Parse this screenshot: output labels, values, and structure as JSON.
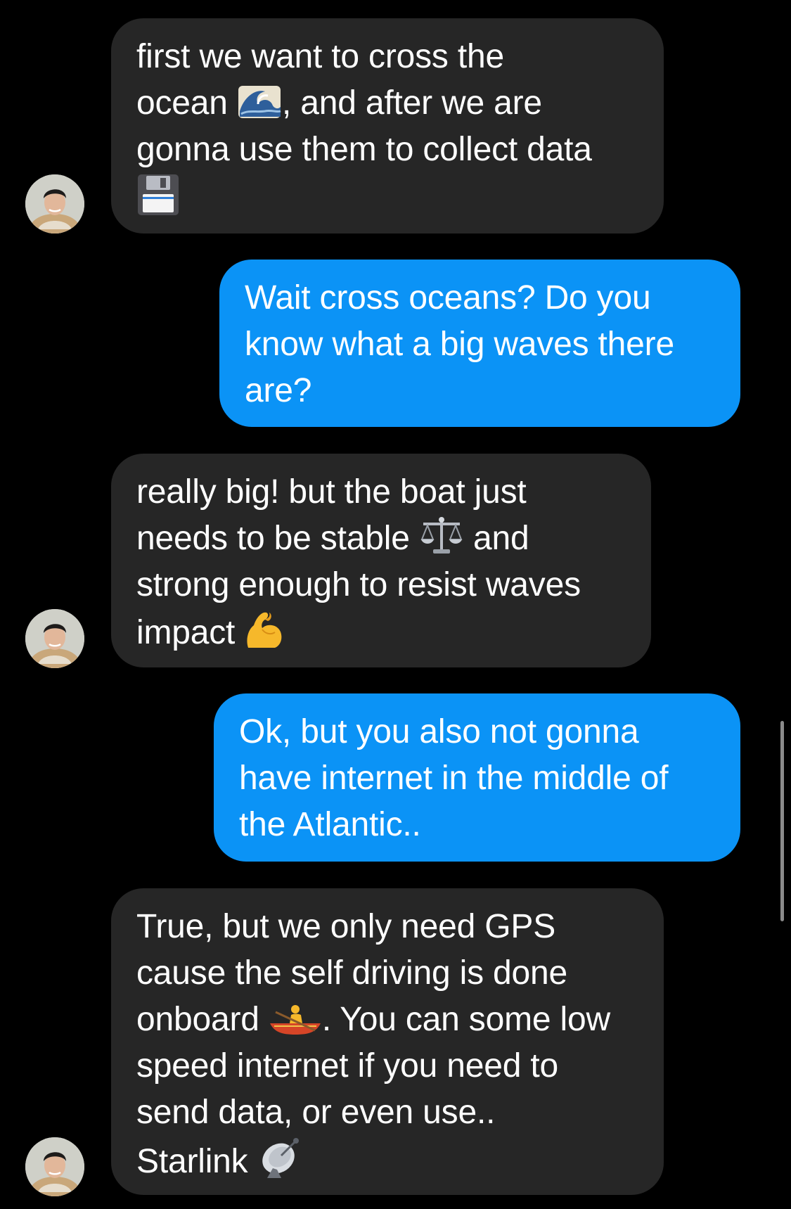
{
  "messages": [
    {
      "sender": "contact",
      "lines": [
        "first we want to cross the",
        "ocean",
        ", and after we are",
        "gonna use them to collect data"
      ],
      "emojis": [
        "wave-emoji",
        "floppy-disk-emoji"
      ]
    },
    {
      "sender": "me",
      "lines": [
        "Wait cross oceans? Do you",
        "know what a big waves there",
        "are?"
      ]
    },
    {
      "sender": "contact",
      "lines": [
        "really big! but the boat just",
        "needs to be stable",
        "and",
        "strong enough to resist waves",
        "impact"
      ],
      "emojis": [
        "balance-scale-emoji",
        "flexed-biceps-emoji"
      ]
    },
    {
      "sender": "me",
      "lines": [
        "Ok, but you also not gonna",
        "have internet in the middle of",
        "the Atlantic.."
      ]
    },
    {
      "sender": "contact",
      "lines": [
        "True, but we only need GPS",
        "cause the self driving is done",
        "onboard",
        ". You can some low",
        "speed internet if you need to",
        "send data, or even use..",
        "Starlink"
      ],
      "emojis": [
        "rowboat-emoji",
        "satellite-antenna-emoji"
      ]
    }
  ],
  "colors": {
    "background": "#000000",
    "incoming_bubble": "#262626",
    "outgoing_bubble": "#0b93f6",
    "text": "#ffffff"
  }
}
